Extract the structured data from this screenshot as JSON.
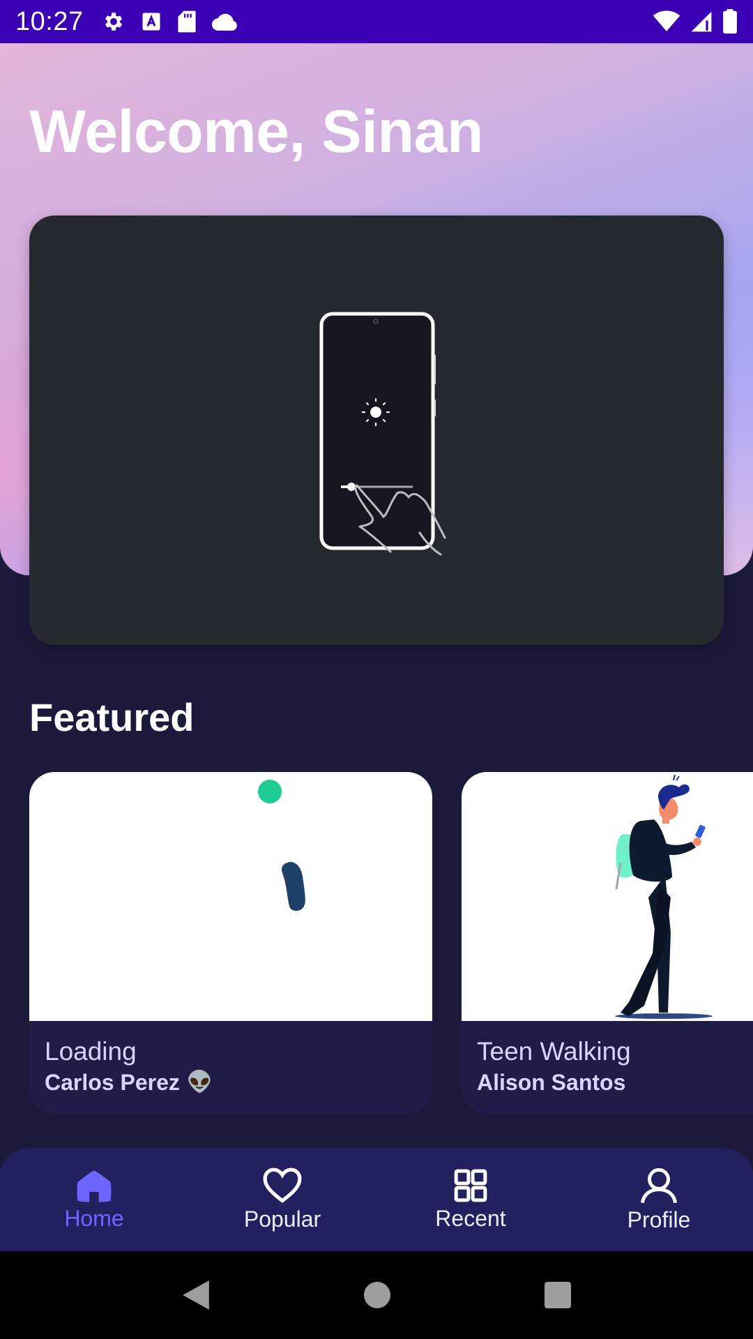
{
  "status_bar": {
    "time": "10:27",
    "left_icons": [
      "gear-icon",
      "a-icon",
      "sd-card-icon",
      "cloud-icon"
    ],
    "right_icons": [
      "wifi-icon",
      "signal-icon",
      "battery-icon"
    ],
    "background": "#3b00b3"
  },
  "header": {
    "title": "Welcome, Sinan"
  },
  "hero": {
    "illustration": "phone-brightness-swipe-illustration"
  },
  "featured": {
    "title": "Featured",
    "cards": [
      {
        "title": "Loading",
        "author": "Carlos Perez",
        "author_emoji": "👽"
      },
      {
        "title": "Teen Walking",
        "author": "Alison Santos"
      }
    ]
  },
  "bottom_nav": {
    "items": [
      {
        "label": "Home",
        "icon": "home-icon",
        "active": true
      },
      {
        "label": "Popular",
        "icon": "heart-icon",
        "active": false
      },
      {
        "label": "Recent",
        "icon": "grid-icon",
        "active": false
      },
      {
        "label": "Profile",
        "icon": "profile-icon",
        "active": false
      }
    ],
    "active_color": "#6e64ff",
    "background": "#232060"
  },
  "system_nav": {
    "buttons": [
      "back-icon",
      "home-circle-icon",
      "recents-square-icon"
    ]
  },
  "colors": {
    "page_background": "#1c1a3b",
    "card_caption_text": "#dcd3ff",
    "hero_card": "#252a31"
  }
}
